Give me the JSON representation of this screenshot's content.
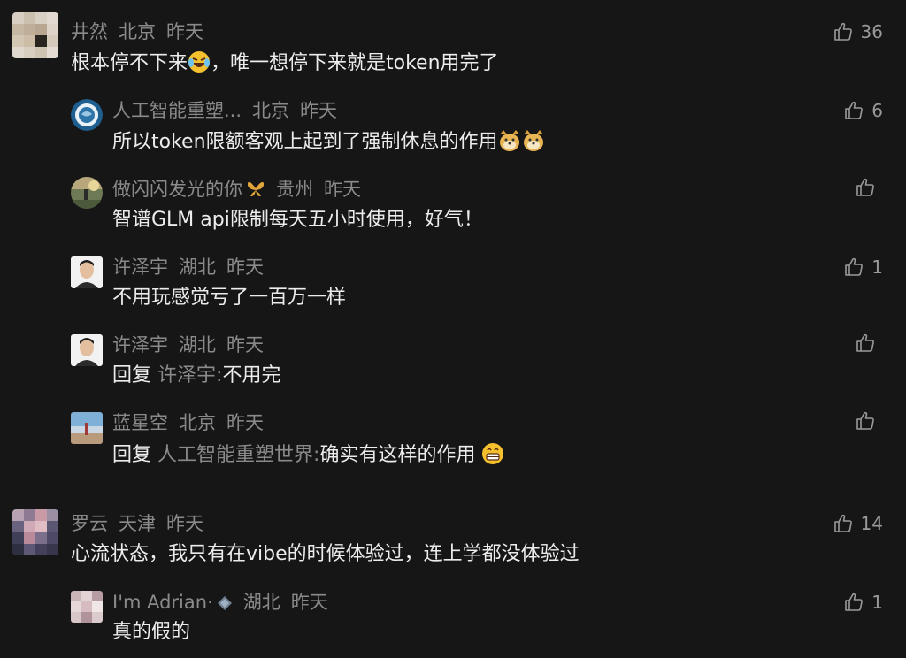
{
  "comments": [
    {
      "user": "井然",
      "location": "北京",
      "time": "昨天",
      "likes": "36",
      "text": "根本停不下来",
      "text_after": "，唯一想停下来就是token用完了",
      "emoji": "laughing-crying-emoji"
    },
    {
      "user": "人工智能重塑...",
      "location": "北京",
      "time": "昨天",
      "likes": "6",
      "text": "所以token限额客观上起到了强制休息的作用",
      "emoji": "doge-emoji"
    },
    {
      "user": "做闪闪发光的你",
      "location": "贵州",
      "time": "昨天",
      "likes": "",
      "text": "智谱GLM api限制每天五小时使用，好气！",
      "badge": "butterfly-badge"
    },
    {
      "user": "许泽宇",
      "location": "湖北",
      "time": "昨天",
      "likes": "1",
      "text": "不用玩感觉亏了一百万一样"
    },
    {
      "user": "许泽宇",
      "location": "湖北",
      "time": "昨天",
      "likes": "",
      "reply_prefix": "回复",
      "reply_target": "许泽宇:",
      "text": "不用完"
    },
    {
      "user": "蓝星空",
      "location": "北京",
      "time": "昨天",
      "likes": "",
      "reply_prefix": "回复",
      "reply_target": "人工智能重塑世界:",
      "text": "确实有这样的作用",
      "emoji": "grin-emoji"
    },
    {
      "user": "罗云",
      "location": "天津",
      "time": "昨天",
      "likes": "14",
      "text": "心流状态，我只有在vibe的时候体验过，连上学都没体验过"
    },
    {
      "user": "I'm Adrian·",
      "location": "湖北",
      "time": "昨天",
      "likes": "1",
      "text": "真的假的",
      "badge": "diamond-badge"
    }
  ],
  "colors": {
    "background": "#161616",
    "text_primary": "#ececec",
    "text_secondary": "#8a8a8a"
  }
}
